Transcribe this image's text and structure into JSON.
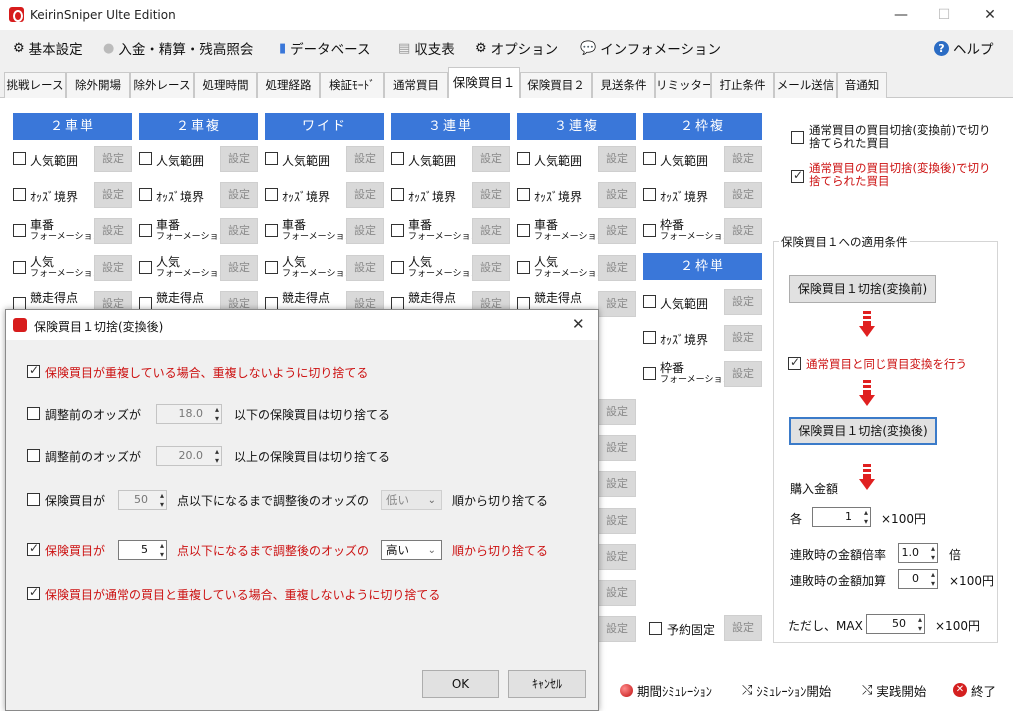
{
  "window": {
    "title": "KeirinSniper Ulte Edition",
    "minimize": "—",
    "maximize": "☐",
    "close": "✕"
  },
  "menu": [
    {
      "label": "基本設定",
      "icon": "⚙"
    },
    {
      "label": "入金・精算・残高照会",
      "icon": "●"
    },
    {
      "label": "データベース",
      "icon": "▮"
    },
    {
      "label": "収支表",
      "icon": "▤"
    },
    {
      "label": "オプション",
      "icon": "⚙"
    },
    {
      "label": "インフォメーション",
      "icon": "💬"
    },
    {
      "label": "ヘルプ",
      "icon": "?"
    }
  ],
  "tabs": [
    "挑戦レース",
    "除外開場",
    "除外レース",
    "処理時間",
    "処理経路",
    "検証ﾓｰﾄﾞ",
    "通常買目",
    "保険買目１",
    "保険買目２",
    "見送条件",
    "リミッター",
    "打止条件",
    "メール送信",
    "音通知"
  ],
  "active_tab": "保険買目１",
  "columns": [
    {
      "header": "２車単",
      "rows": [
        "人気範囲",
        "ｵｯｽﾞ境界",
        [
          "車番",
          "フォーメーション"
        ],
        [
          "人気",
          "フォーメーション"
        ],
        [
          "競走得点",
          ""
        ]
      ]
    },
    {
      "header": "２車複",
      "rows": [
        "人気範囲",
        "ｵｯｽﾞ境界",
        [
          "車番",
          "フォーメーション"
        ],
        [
          "人気",
          "フォーメーション"
        ],
        [
          "競走得点",
          ""
        ]
      ]
    },
    {
      "header": "ワイド",
      "rows": [
        "人気範囲",
        "ｵｯｽﾞ境界",
        [
          "車番",
          "フォーメーション"
        ],
        [
          "人気",
          "フォーメーション"
        ],
        [
          "競走得点",
          ""
        ]
      ]
    },
    {
      "header": "３連単",
      "rows": [
        "人気範囲",
        "ｵｯｽﾞ境界",
        [
          "車番",
          "フォーメーション"
        ],
        [
          "人気",
          "フォーメーション"
        ],
        [
          "競走得点",
          ""
        ]
      ]
    },
    {
      "header": "３連複",
      "rows": [
        "人気範囲",
        "ｵｯｽﾞ境界",
        [
          "車番",
          "フォーメーション"
        ],
        [
          "人気",
          "フォーメーション"
        ],
        [
          "競走得点",
          ""
        ]
      ]
    },
    {
      "header": "２枠複",
      "rows": [
        "人気範囲",
        "ｵｯｽﾞ境界",
        [
          "枠番",
          "フォーメーション"
        ]
      ]
    }
  ],
  "waku_tan": {
    "header": "２枠単",
    "rows": [
      "人気範囲",
      "ｵｯｽﾞ境界",
      [
        "枠番",
        "フォーメーション"
      ]
    ]
  },
  "set_label": "設定",
  "yoyaku_label": "予約固定",
  "right": {
    "cut_before": "通常買目の買目切捨(変換前)で切り捨てられた買目",
    "cut_after": "通常買目の買目切捨(変換後)で切り捨てられた買目",
    "group_title": "保険買目１への適用条件",
    "btn_before": "保険買目１切捨(変換前)",
    "same_conv": "通常買目と同じ買目変換を行う",
    "btn_after": "保険買目１切捨(変換後)",
    "buy_amount": "購入金額",
    "each": "各",
    "each_value": "1",
    "unit": "×100円",
    "rate_label": "連敗時の金額倍率",
    "rate_value": "1.0",
    "rate_unit": "倍",
    "add_label": "連敗時の金額加算",
    "add_value": "0",
    "max_label": "ただし、MAX",
    "max_value": "50"
  },
  "bottom": {
    "sim_period": "期間ｼﾐｭﾚｰｼｮﾝ",
    "sim_start": "ｼﾐｭﾚｰｼｮﾝ開始",
    "live_start": "実践開始",
    "exit": "終了"
  },
  "dialog": {
    "title": "保険買目１切捨(変換後)",
    "line1": "保険買目が重複している場合、重複しないように切り捨てる",
    "line2_pre": "調整前のオッズが",
    "line2_val": "18.0",
    "line2_post": "以下の保険買目は切り捨てる",
    "line3_pre": "調整前のオッズが",
    "line3_val": "20.0",
    "line3_post": "以上の保険買目は切り捨てる",
    "line4_pre": "保険買目が",
    "line4_val": "50",
    "line4_mid": "点以下になるまで調整後のオッズの",
    "line4_sel": "低い",
    "line4_post": "順から切り捨てる",
    "line5_pre": "保険買目が",
    "line5_val": "5",
    "line5_mid": "点以下になるまで調整後のオッズの",
    "line5_sel": "高い",
    "line5_post": "順から切り捨てる",
    "line6": "保険買目が通常の買目と重複している場合、重複しないように切り捨てる",
    "ok": "OK",
    "cancel": "ｷｬﾝｾﾙ"
  },
  "colors": {
    "header_blue": "#3a77d9",
    "red_text": "#cc1111",
    "arrow_red": "#e02020"
  }
}
